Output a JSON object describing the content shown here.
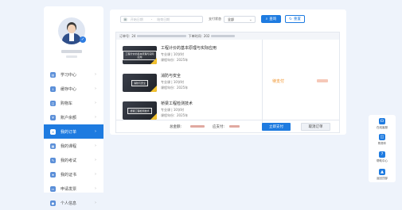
{
  "user": {
    "verified_icon": "check-badge-icon",
    "name_visible": false
  },
  "sidebar": {
    "items": [
      {
        "label": "学习中心",
        "icon": "book-icon",
        "active": false
      },
      {
        "label": "缓存中心",
        "icon": "download-icon",
        "active": false
      },
      {
        "label": "购物车",
        "icon": "cart-icon",
        "active": false
      },
      {
        "label": "账户余额",
        "icon": "wallet-icon",
        "active": false
      },
      {
        "label": "我的订单",
        "icon": "order-icon",
        "active": true
      },
      {
        "label": "我的课程",
        "icon": "course-icon",
        "active": false
      },
      {
        "label": "我的考试",
        "icon": "exam-icon",
        "active": false
      },
      {
        "label": "我的证书",
        "icon": "certificate-icon",
        "active": false
      },
      {
        "label": "申请发票",
        "icon": "invoice-icon",
        "active": false
      },
      {
        "label": "个人信息",
        "icon": "user-icon",
        "active": false
      }
    ],
    "chevron": "›"
  },
  "filter": {
    "start_placeholder": "开始日期",
    "separator": "-",
    "end_placeholder": "结束日期",
    "status_label": "支付状态",
    "status_value": "全部",
    "query_button": "查询",
    "reset_button": "重置"
  },
  "order": {
    "number_label": "订单号:",
    "number_prefix": "24",
    "time_label": "下单时间:",
    "time_prefix": "202",
    "courses": [
      {
        "title": "工程计价的基本原理与实际应用",
        "thumb_text": "工程计价的基本原理与实际应用",
        "credits": "专业课 | 10学时",
        "year": "课程年份：2025年"
      },
      {
        "title": "消防与安全",
        "thumb_text": "消防与安全",
        "credits": "专业课 | 10学时",
        "year": "课程年份：2025年"
      },
      {
        "title": "桥梁工程检测技术",
        "thumb_text": "桥梁工程检测技术",
        "credits": "专业课 | 10学时",
        "year": "课程年份：2025年"
      }
    ],
    "status": "待支付",
    "total_label": "总金额:",
    "paid_label": "应支付:",
    "pay_button": "立即支付",
    "cancel_button": "取消订单"
  },
  "rightbar": {
    "items": [
      {
        "label": "在线客服",
        "icon": "headset-icon"
      },
      {
        "label": "购物车",
        "icon": "cart-icon"
      },
      {
        "label": "帮助中心",
        "icon": "help-icon"
      },
      {
        "label": "返回顶部",
        "icon": "top-icon"
      }
    ]
  },
  "colors": {
    "accent": "#1e7be0",
    "pending": "#f08c1a",
    "background": "#eef3fb"
  }
}
